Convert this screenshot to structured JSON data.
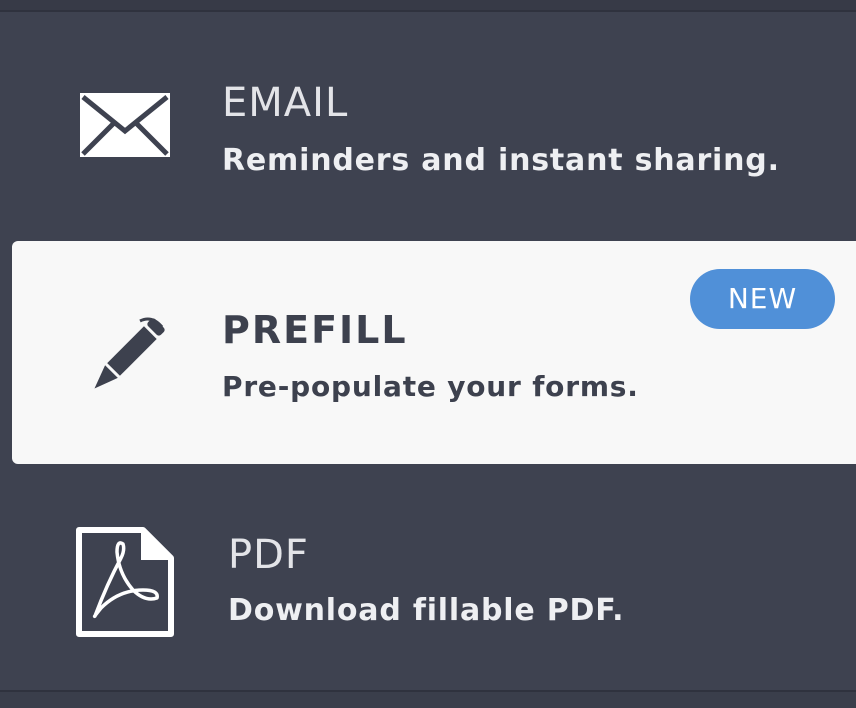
{
  "colors": {
    "background": "#3e4250",
    "selected_background": "#f8f8f8",
    "badge": "#5090d8",
    "light_text": "#eeeff2",
    "dark_text": "#3d414e"
  },
  "options": [
    {
      "title": "EMAIL",
      "description": "Reminders and instant sharing.",
      "icon": "envelope-icon"
    },
    {
      "title": "PREFILL",
      "description": "Pre-populate your forms.",
      "icon": "pencil-icon",
      "badge": "NEW",
      "selected": true
    },
    {
      "title": "PDF",
      "description": "Download fillable PDF.",
      "icon": "pdf-file-icon"
    }
  ]
}
